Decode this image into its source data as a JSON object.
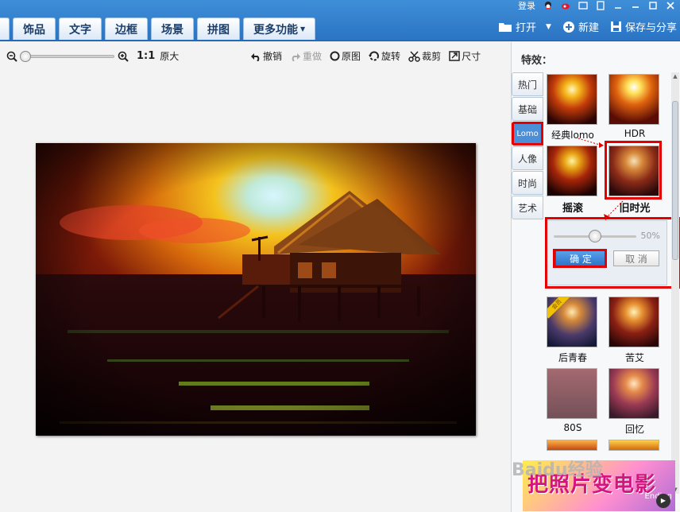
{
  "system": {
    "login": "登录"
  },
  "tabs": [
    {
      "label": "饰品"
    },
    {
      "label": "文字"
    },
    {
      "label": "边框"
    },
    {
      "label": "场景"
    },
    {
      "label": "拼图"
    },
    {
      "label": "更多功能"
    }
  ],
  "toptools": {
    "open": "打开",
    "new": "新建",
    "save_share": "保存与分享"
  },
  "toolbar": {
    "ratio": "1:1",
    "ratio_label": "原大",
    "undo": "撤销",
    "redo": "重做",
    "original": "原图",
    "rotate": "旋转",
    "crop": "裁剪",
    "size": "尺寸"
  },
  "panel": {
    "title": "特效：",
    "categories": [
      {
        "label": "热门"
      },
      {
        "label": "基础"
      },
      {
        "label": "Lomo"
      },
      {
        "label": "人像"
      },
      {
        "label": "时尚"
      },
      {
        "label": "艺术"
      }
    ],
    "active_category": "Lomo",
    "effects": [
      {
        "label": "经典lomo"
      },
      {
        "label": "HDR"
      },
      {
        "label": "摇滚"
      },
      {
        "label": "旧时光"
      },
      {
        "label": "后青春",
        "badge": "会员"
      },
      {
        "label": "苦艾"
      },
      {
        "label": "80S"
      },
      {
        "label": "回忆"
      }
    ],
    "adjust": {
      "percent": "50%",
      "ok_label": "确 定",
      "cancel_label": "取 消",
      "level": 0.5
    },
    "ad": {
      "text": "把照片变电影",
      "sub": "Ending"
    }
  },
  "watermark": "Baidu经验",
  "colors": {
    "accent_blue": "#2a74c3",
    "highlight_red": "#e30000"
  }
}
